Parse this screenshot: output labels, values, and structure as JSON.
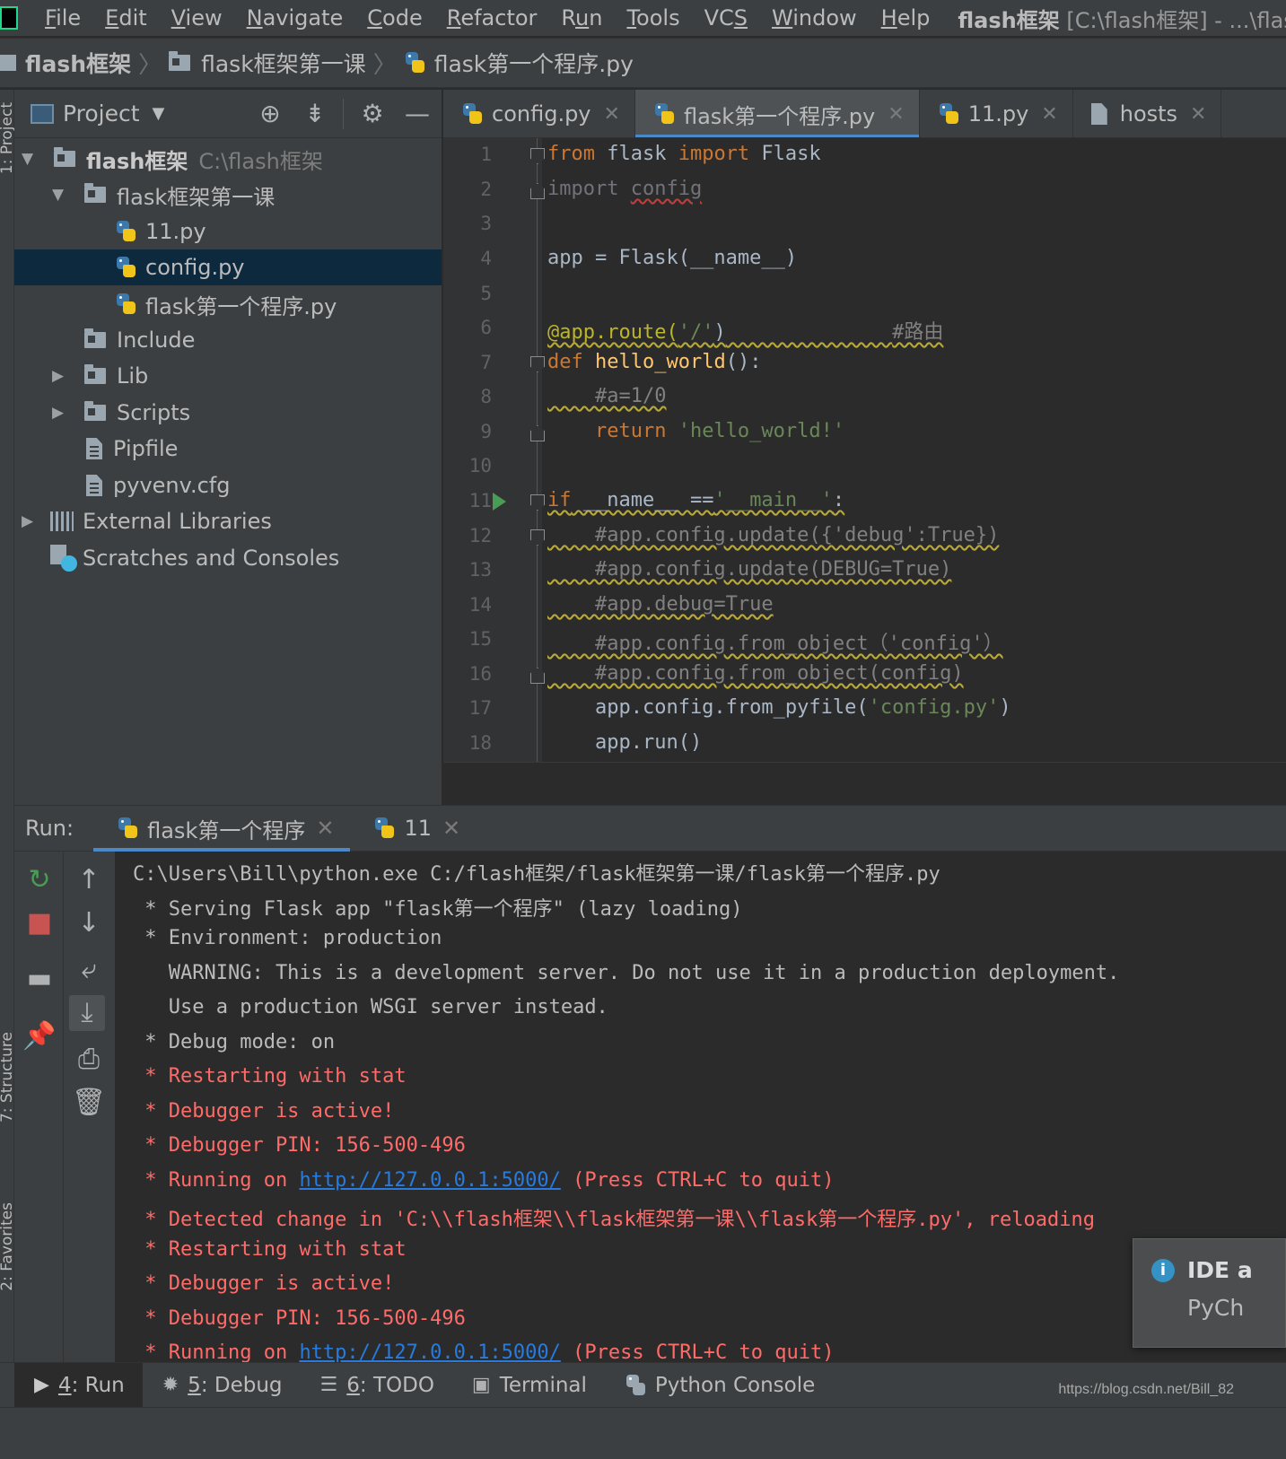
{
  "menubar": {
    "items": [
      "File",
      "Edit",
      "View",
      "Navigate",
      "Code",
      "Refactor",
      "Run",
      "Tools",
      "VCS",
      "Window",
      "Help"
    ],
    "mnemonics": [
      "F",
      "E",
      "V",
      "N",
      "C",
      "R",
      "u",
      "T",
      "S",
      "W",
      "H"
    ],
    "window_title_project": "flash框架",
    "window_title_rest": " [C:\\flash框架] - ...\\flask第一"
  },
  "breadcrumb": {
    "items": [
      "flash框架",
      "flask框架第一课",
      "flask第一个程序.py"
    ]
  },
  "left_strip": {
    "project_label": "1: Project",
    "structure_label": "7: Structure",
    "favorites_label": "2: Favorites"
  },
  "project_panel": {
    "title": "Project",
    "tree": [
      {
        "label": "flash框架",
        "path": "C:\\flash框架",
        "type": "folder",
        "expanded": true
      },
      {
        "label": "flask框架第一课",
        "type": "folder",
        "expanded": true
      },
      {
        "label": "11.py",
        "type": "python"
      },
      {
        "label": "config.py",
        "type": "python",
        "selected": true
      },
      {
        "label": "flask第一个程序.py",
        "type": "python"
      },
      {
        "label": "Include",
        "type": "folder"
      },
      {
        "label": "Lib",
        "type": "folder",
        "expanded": false
      },
      {
        "label": "Scripts",
        "type": "folder",
        "expanded": false
      },
      {
        "label": "Pipfile",
        "type": "file"
      },
      {
        "label": "pyvenv.cfg",
        "type": "file"
      },
      {
        "label": "External Libraries",
        "type": "libraries",
        "expanded": false
      },
      {
        "label": "Scratches and Consoles",
        "type": "scratches"
      }
    ]
  },
  "editor": {
    "tabs": [
      {
        "label": "config.py",
        "active": false
      },
      {
        "label": "flask第一个程序.py",
        "active": true
      },
      {
        "label": "11.py",
        "active": false
      },
      {
        "label": "hosts",
        "active": false
      }
    ],
    "line_numbers": [
      "1",
      "2",
      "3",
      "4",
      "5",
      "6",
      "7",
      "8",
      "9",
      "10",
      "11",
      "12",
      "13",
      "14",
      "15",
      "16",
      "17",
      "18"
    ],
    "code": {
      "l1_from": "from",
      "l1_mod": " flask ",
      "l1_import": "import",
      "l1_name": " Flask",
      "l2_import": "import ",
      "l2_mod": "config",
      "l4": "app = Flask(__name__)",
      "l6_deco": "@app.route(",
      "l6_str": "'/'",
      "l6_close": ")",
      "l6_pad": "              ",
      "l6_cmt": "#路由",
      "l7_def": "def",
      "l7_fn": " hello_world",
      "l7_rest": "():",
      "l8": "    #a=1/0",
      "l9_ret": "    return",
      "l9_str": " 'hello_world!'",
      "l11_if": "if",
      "l11_rest": " __name__ ==",
      "l11_str": "'__main__'",
      "l11_colon": ":",
      "l12": "    #app.config.update({'debug':True})",
      "l13": "    #app.config.update(DEBUG=True)",
      "l14": "    #app.debug=True",
      "l15": "    #app.config.from_object（'config'）",
      "l16": "    #app.config.from_object(config)",
      "l17_pre": "    app.config.from_pyfile(",
      "l17_str": "'config.py'",
      "l17_post": ")",
      "l18": "    app.run()"
    }
  },
  "run_panel": {
    "label": "Run:",
    "tabs": [
      {
        "label": "flask第一个程序",
        "active": true
      },
      {
        "label": "11",
        "active": false
      }
    ],
    "console": [
      {
        "text": "C:\\Users\\Bill\\python.exe C:/flash框架/flask框架第一课/flask第一个程序.py",
        "style": "normal"
      },
      {
        "text": " * Serving Flask app \"flask第一个程序\" (lazy loading)",
        "style": "normal"
      },
      {
        "text": " * Environment: production",
        "style": "normal"
      },
      {
        "text": "   WARNING: This is a development server. Do not use it in a production deployment.",
        "style": "normal"
      },
      {
        "text": "   Use a production WSGI server instead.",
        "style": "normal"
      },
      {
        "text": " * Debug mode: on",
        "style": "normal"
      },
      {
        "text": " * Restarting with stat",
        "style": "error"
      },
      {
        "text": " * Debugger is active!",
        "style": "error"
      },
      {
        "text": " * Debugger PIN: 156-500-496",
        "style": "error"
      },
      {
        "text": " * Running on ",
        "link": "http://127.0.0.1:5000/",
        "after": " (Press CTRL+C to quit)",
        "style": "error"
      },
      {
        "text": " * Detected change in 'C:\\\\flash框架\\\\flask框架第一课\\\\flask第一个程序.py', reloading",
        "style": "error"
      },
      {
        "text": " * Restarting with stat",
        "style": "error"
      },
      {
        "text": " * Debugger is active!",
        "style": "error"
      },
      {
        "text": " * Debugger PIN: 156-500-496",
        "style": "error"
      },
      {
        "text": " * Running on ",
        "link": "http://127.0.0.1:5000/",
        "after": " (Press CTRL+C to quit)",
        "style": "error"
      }
    ]
  },
  "notification": {
    "title": "IDE a",
    "body": "PyCh"
  },
  "bottom_bar": {
    "items": [
      {
        "num": "4",
        "label": ": Run",
        "active": true
      },
      {
        "num": "5",
        "label": ": Debug",
        "active": false
      },
      {
        "num": "6",
        "label": ": TODO",
        "active": false
      },
      {
        "num": "",
        "label": "Terminal",
        "active": false
      },
      {
        "num": "",
        "label": "Python Console",
        "active": false
      }
    ],
    "watermark": "https://blog.csdn.net/Bill_82"
  },
  "colors": {
    "background": "#2b2b2b",
    "panel": "#3c3f41",
    "selection": "#0d293e",
    "accent_tab": "#4a88c7",
    "console_error": "#ff6b68",
    "link": "#287bde",
    "keyword": "#cc7832",
    "string": "#6a8759",
    "comment": "#808080",
    "function": "#ffc66d"
  }
}
